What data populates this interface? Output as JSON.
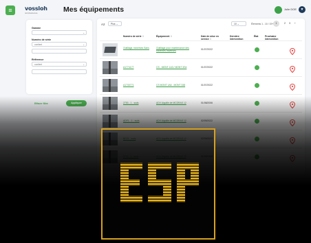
{
  "header": {
    "menu_icon": "grid-menu-icon",
    "logo_brand": "vossloh",
    "logo_tagline": "rail infrastructure",
    "page_title": "Mes équipements",
    "user_name": "Julie DOE",
    "user_menu_icon": "chevron-down-icon"
  },
  "filters": {
    "gamme_label": "Gamme",
    "gamme_value": "",
    "serial_label": "Numéro de série",
    "serial_value": "contient",
    "serial_input": "",
    "reference_label": "Référence",
    "reference_value": "contient",
    "reference_input": "",
    "reset_label": "Effacer filtre",
    "apply_label": "Appliquer"
  },
  "table": {
    "tag": "A2",
    "plus_label": "Plus",
    "per_page": "10",
    "range_text": "Éléments 1 - 10 / 19+",
    "pages": [
      "1",
      "2",
      "3"
    ],
    "columns": {
      "serial": "Numéro de série",
      "equipment": "Équipement",
      "date": "Date de mise en service",
      "last": "Dernière intervention",
      "status": "État",
      "next": "Prochaine intervention"
    },
    "rows": [
      {
        "serial": "Outillage, traverses Sans",
        "equipment": "Outillage pour maintenance des traverses traverses",
        "date": "01/07/2022",
        "last": "",
        "next": ""
      },
      {
        "serial": "A1774177",
        "equipment": "CS - MONT 1A3 / MONT 3S4",
        "date": "01/07/2022",
        "last": "",
        "next": ""
      },
      {
        "serial": "A1733771",
        "equipment": "CS MONT 1A6 - MONT 338",
        "date": "01/07/2022",
        "last": "",
        "next": ""
      },
      {
        "serial": "2753 - 1 - ssds",
        "equipment": "ADV Aiguille de MCDRAS 12",
        "date": "01/08/2006",
        "last": "",
        "next": ""
      },
      {
        "serial": "ADF1 - 1 - ssds",
        "equipment": "ADV Aiguille de MCDRAS 12",
        "date": "02/09/2022",
        "last": "",
        "next": ""
      },
      {
        "serial": "BD01 - ssds",
        "equipment": "ADV Aiguille de MCDRAS 12",
        "date": "02/09/2022",
        "last": "",
        "next": ""
      },
      {
        "serial": "2752 - 1 - ssds",
        "equipment": "ADV Aiguille de MCDRAS 12",
        "date": "01/08/2006",
        "last": "",
        "next": ""
      }
    ],
    "status_color": "#4caf50",
    "pin_color": "#e53935",
    "link_color": "#3a9a47"
  },
  "overlay": {
    "badge_text": "ESP",
    "badge_border_color": "#d9a21e"
  }
}
